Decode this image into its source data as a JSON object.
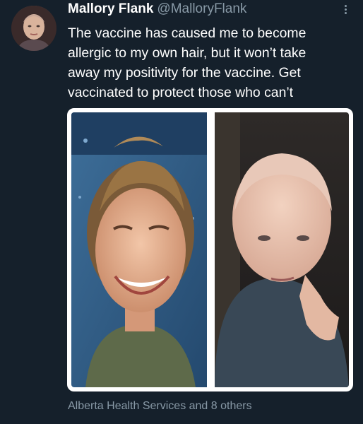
{
  "tweet": {
    "display_name": "Mallory Flank",
    "handle": "@MalloryFlank",
    "text_lines": [
      "The vaccine has caused me to become",
      "allergic to my own hair, but it won’t take",
      "away my positivity for the vaccine. Get",
      "vaccinated to protect those who can’t"
    ],
    "liked_by": "Alberta Health Services and 8 others"
  },
  "icons": {
    "more": "more-options-icon"
  },
  "colors": {
    "background": "#15202b",
    "text": "#ffffff",
    "muted": "#8899a6",
    "photo_border": "#ffffff"
  }
}
